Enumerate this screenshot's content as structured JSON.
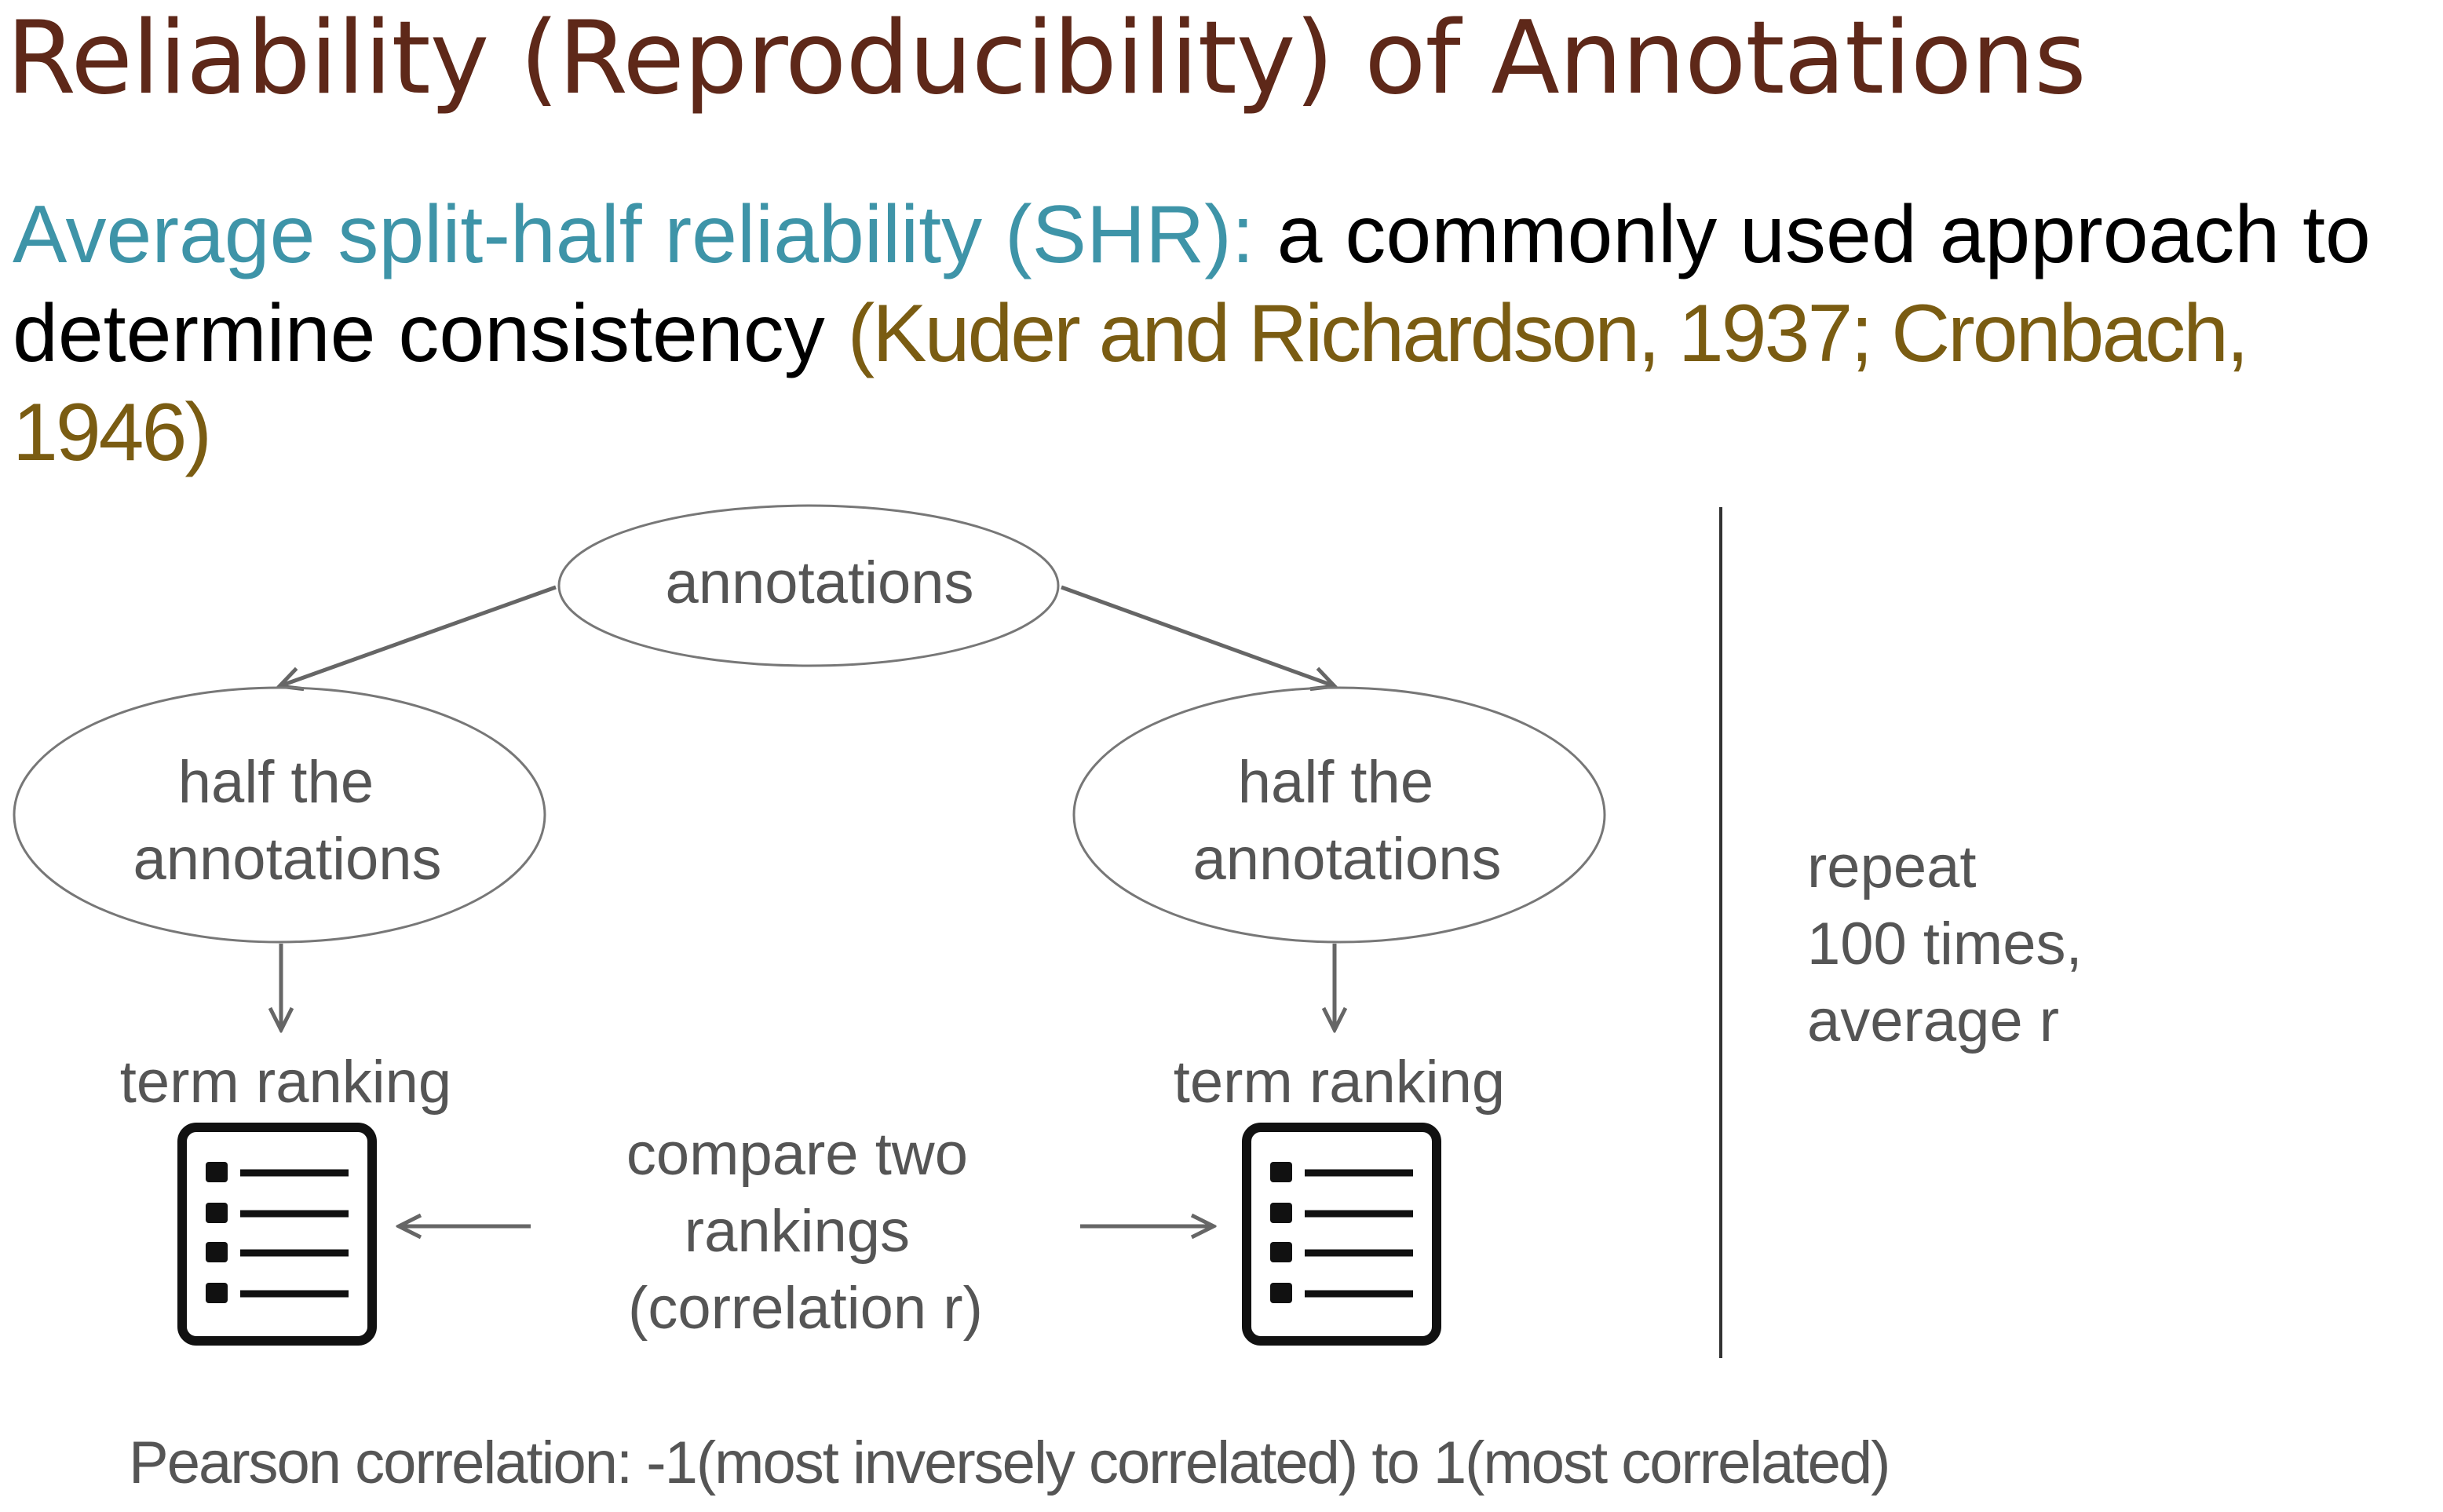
{
  "slide": {
    "title": "Reliability (Reproducibility) of Annotations",
    "intro": {
      "term": "Average split-half reliability (SHR):",
      "text": " a commonly used approach to determine consistency ",
      "citation": "(Kuder and Richardson, 1937; Cronbach, 1946)"
    },
    "footnote": "Pearson correlation: -1(most inversely correlated) to 1(most correlated)"
  },
  "diagram": {
    "root_node": "annotations",
    "left_half": [
      "half the",
      "annotations"
    ],
    "right_half": [
      "half the",
      "annotations"
    ],
    "left_ranking": "term ranking",
    "right_ranking": "term ranking",
    "compare": [
      "compare two",
      "rankings",
      "(correlation r)"
    ],
    "repeat": [
      "repeat",
      "100 times,",
      "average r"
    ],
    "list_icon": "list-document-icon"
  },
  "colors": {
    "title": "#5e2819",
    "term": "#3e94a8",
    "citation": "#7a5c12",
    "diagram_text": "#555555",
    "diagram_lines": "#666666"
  }
}
